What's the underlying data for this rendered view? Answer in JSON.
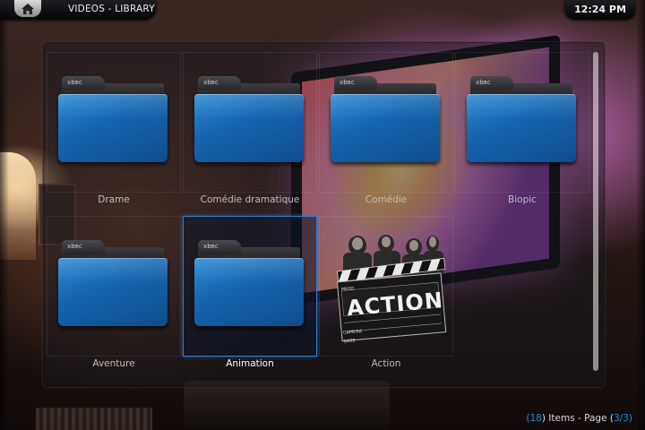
{
  "header": {
    "title": "VIDEOS - LIBRARY",
    "clock": "12:24 PM",
    "home_icon": "home-icon"
  },
  "grid": {
    "items": [
      {
        "label": "Drame",
        "type": "folder",
        "badge": "xbmc"
      },
      {
        "label": "Comédie dramatique",
        "type": "folder",
        "badge": "xbmc"
      },
      {
        "label": "Comédie",
        "type": "folder",
        "badge": "xbmc"
      },
      {
        "label": "Biopic",
        "type": "folder",
        "badge": "xbmc"
      },
      {
        "label": "Aventure",
        "type": "folder",
        "badge": "xbmc"
      },
      {
        "label": "Animation",
        "type": "folder",
        "badge": "xbmc",
        "focused": true
      },
      {
        "label": "Action",
        "type": "clapperboard",
        "art_text": "ACTION",
        "art_board_labels": [
          "PROD",
          "CAMERA",
          "DATE"
        ]
      }
    ]
  },
  "footer": {
    "count_open": "(",
    "count": "18",
    "count_text": ") Items - Page (",
    "page": "3/3",
    "page_close": ")"
  },
  "colors": {
    "accent": "#2a87e0",
    "folder_blue": "#1766b0"
  }
}
